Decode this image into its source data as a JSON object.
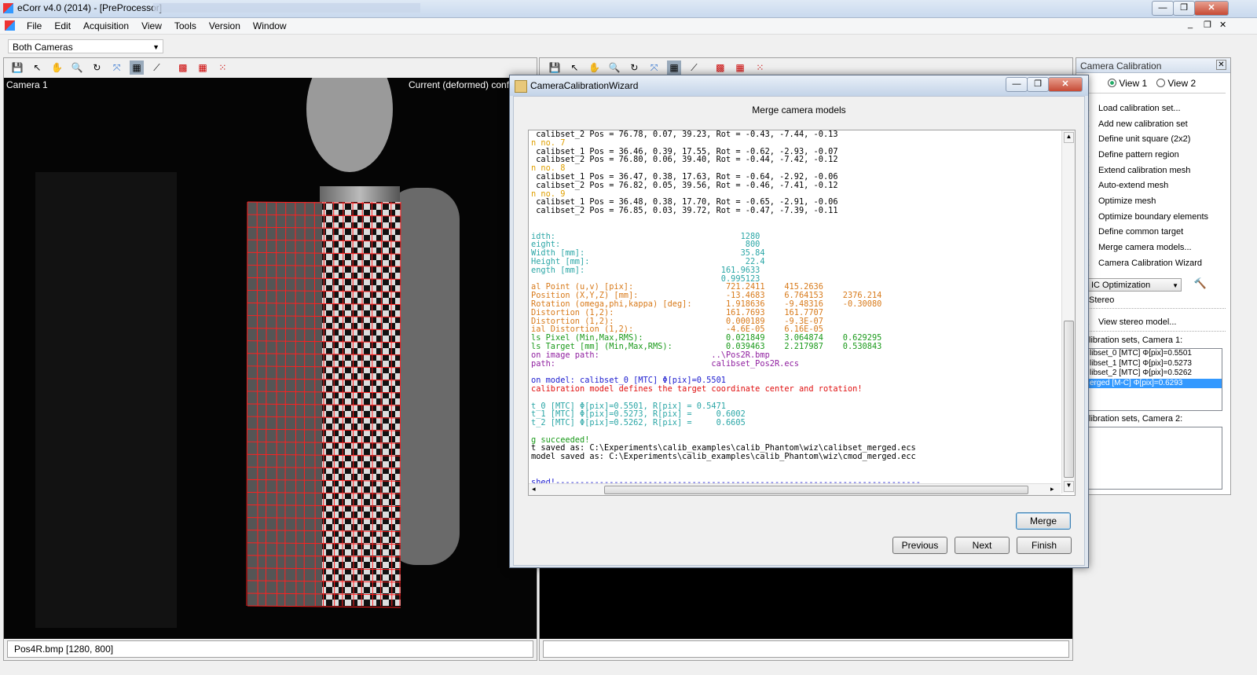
{
  "window": {
    "title": "eCorr v4.0 (2014) - [PreProcessor]",
    "min_glyph": "—",
    "max_glyph": "❐",
    "close_glyph": "✕"
  },
  "menu": [
    "File",
    "Edit",
    "Acquisition",
    "View",
    "Tools",
    "Version",
    "Window"
  ],
  "mdi_controls": [
    "_",
    "❐",
    "✕"
  ],
  "camera_select": {
    "value": "Both Cameras"
  },
  "left_view": {
    "camera_label": "Camera 1",
    "overlay_text": "Current (deformed) config",
    "status": "Pos4R.bmp [1280, 800]"
  },
  "dialog": {
    "title": "CameraCalibrationWizard",
    "heading": "Merge camera models",
    "merge_button": "Merge",
    "previous_button": "Previous",
    "next_button": "Next",
    "finish_button": "Finish",
    "log": [
      {
        "c": "blk",
        "t": " calibset_2 Pos = 76.78, 0.07, 39.23, Rot = -0.43, -7.44, -0.13"
      },
      {
        "c": "org",
        "t": "n no. 7"
      },
      {
        "c": "blk",
        "t": " calibset_1 Pos = 36.46, 0.39, 17.55, Rot = -0.62, -2.93, -0.07"
      },
      {
        "c": "blk",
        "t": " calibset_2 Pos = 76.80, 0.06, 39.40, Rot = -0.44, -7.42, -0.12"
      },
      {
        "c": "org",
        "t": "n no. 8"
      },
      {
        "c": "blk",
        "t": " calibset_1 Pos = 36.47, 0.38, 17.63, Rot = -0.64, -2.92, -0.06"
      },
      {
        "c": "blk",
        "t": " calibset_2 Pos = 76.82, 0.05, 39.56, Rot = -0.46, -7.41, -0.12"
      },
      {
        "c": "org",
        "t": "n no. 9"
      },
      {
        "c": "blk",
        "t": " calibset_1 Pos = 36.48, 0.38, 17.70, Rot = -0.65, -2.91, -0.06"
      },
      {
        "c": "blk",
        "t": " calibset_2 Pos = 76.85, 0.03, 39.72, Rot = -0.47, -7.39, -0.11"
      },
      {
        "c": "blk",
        "t": " "
      },
      {
        "c": "blk",
        "t": " "
      },
      {
        "c": "teal",
        "t": "idth:                                      1280"
      },
      {
        "c": "teal",
        "t": "eight:                                      800"
      },
      {
        "c": "teal",
        "t": "Width [mm]:                                35.84"
      },
      {
        "c": "teal",
        "t": "Height [mm]:                                22.4"
      },
      {
        "c": "teal",
        "t": "ength [mm]:                            161.9633"
      },
      {
        "c": "teal",
        "t": "                                       0.995123"
      },
      {
        "c": "brn",
        "t": "al Point (u,v) [pix]:                   721.2411    415.2636"
      },
      {
        "c": "brn",
        "t": "Position (X,Y,Z) [mm]:                  -13.4683    6.764153    2376.214"
      },
      {
        "c": "brn",
        "t": "Rotation (omega,phi,kappa) [deg]:       1.918636    -9.48316    -0.30080"
      },
      {
        "c": "brn",
        "t": "Distortion (1,2):                       161.7693    161.7707"
      },
      {
        "c": "brn",
        "t": "Distortion (1,2):                       0.000189    -9.3E-07"
      },
      {
        "c": "brn",
        "t": "ial Distortion (1,2):                   -4.6E-05    6.16E-05"
      },
      {
        "c": "grn",
        "t": "ls Pixel (Min,Max,RMS):                 0.021849    3.064874    0.629295"
      },
      {
        "c": "grn",
        "t": "ls Target [mm] (Min,Max,RMS):           0.039463    2.217987    0.530843"
      },
      {
        "c": "pur",
        "t": "on image path:                       ..\\Pos2R.bmp"
      },
      {
        "c": "pur",
        "t": "path:                                calibset_Pos2R.ecs"
      },
      {
        "c": "blk",
        "t": " "
      },
      {
        "c": "blu",
        "t": "on model: calibset_0 [MTC] Φ[pix]=0.5501"
      },
      {
        "c": "red",
        "t": "calibration model defines the target coordinate center and rotation!"
      },
      {
        "c": "blk",
        "t": " "
      },
      {
        "c": "teal",
        "t": "t_0 [MTC] Φ[pix]=0.5501, R[pix] = 0.5471"
      },
      {
        "c": "teal",
        "t": "t_1 [MTC] Φ[pix]=0.5273, R[pix] =     0.6002"
      },
      {
        "c": "teal",
        "t": "t_2 [MTC] Φ[pix]=0.5262, R[pix] =     0.6605"
      },
      {
        "c": "blk",
        "t": " "
      },
      {
        "c": "grn",
        "t": "g succeeded!"
      },
      {
        "c": "blk",
        "t": "t saved as: C:\\Experiments\\calib_examples\\calib_Phantom\\wiz\\calibset_merged.ecs"
      },
      {
        "c": "blk",
        "t": "model saved as: C:\\Experiments\\calib_examples\\calib_Phantom\\wiz\\cmod_merged.ecc"
      },
      {
        "c": "blk",
        "t": " "
      },
      {
        "c": "blk",
        "t": " "
      },
      {
        "c": "blu",
        "t": "shed!---------------------------------------------------------------------------"
      }
    ]
  },
  "right_panel": {
    "title": "Camera Calibration",
    "view1_label": "View 1",
    "view2_label": "View 2",
    "actions": [
      "Load calibration set...",
      "Add new calibration set",
      "Define unit square (2x2)",
      "Define pattern region",
      "Extend calibration mesh",
      "Auto-extend mesh",
      "Optimize mesh",
      "Optimize boundary elements",
      "Define common target",
      "Merge camera models...",
      "Camera Calibration Wizard"
    ],
    "optimization_select": "IC Optimization",
    "stereo_label": "Stereo",
    "view_stereo": "View stereo model...",
    "sets_cam1_label": "libration sets, Camera 1:",
    "sets_cam1": [
      "libset_0 [MTC] Φ[pix]=0.5501",
      "libset_1 [MTC] Φ[pix]=0.5273",
      "libset_2 [MTC] Φ[pix]=0.5262",
      "erged [M-C] Φ[pix]=0.6293"
    ],
    "sets_cam2_label": "libration sets, Camera 2:"
  },
  "colors": {
    "selection": "#3399ff",
    "grid_line": "#ff2020"
  }
}
